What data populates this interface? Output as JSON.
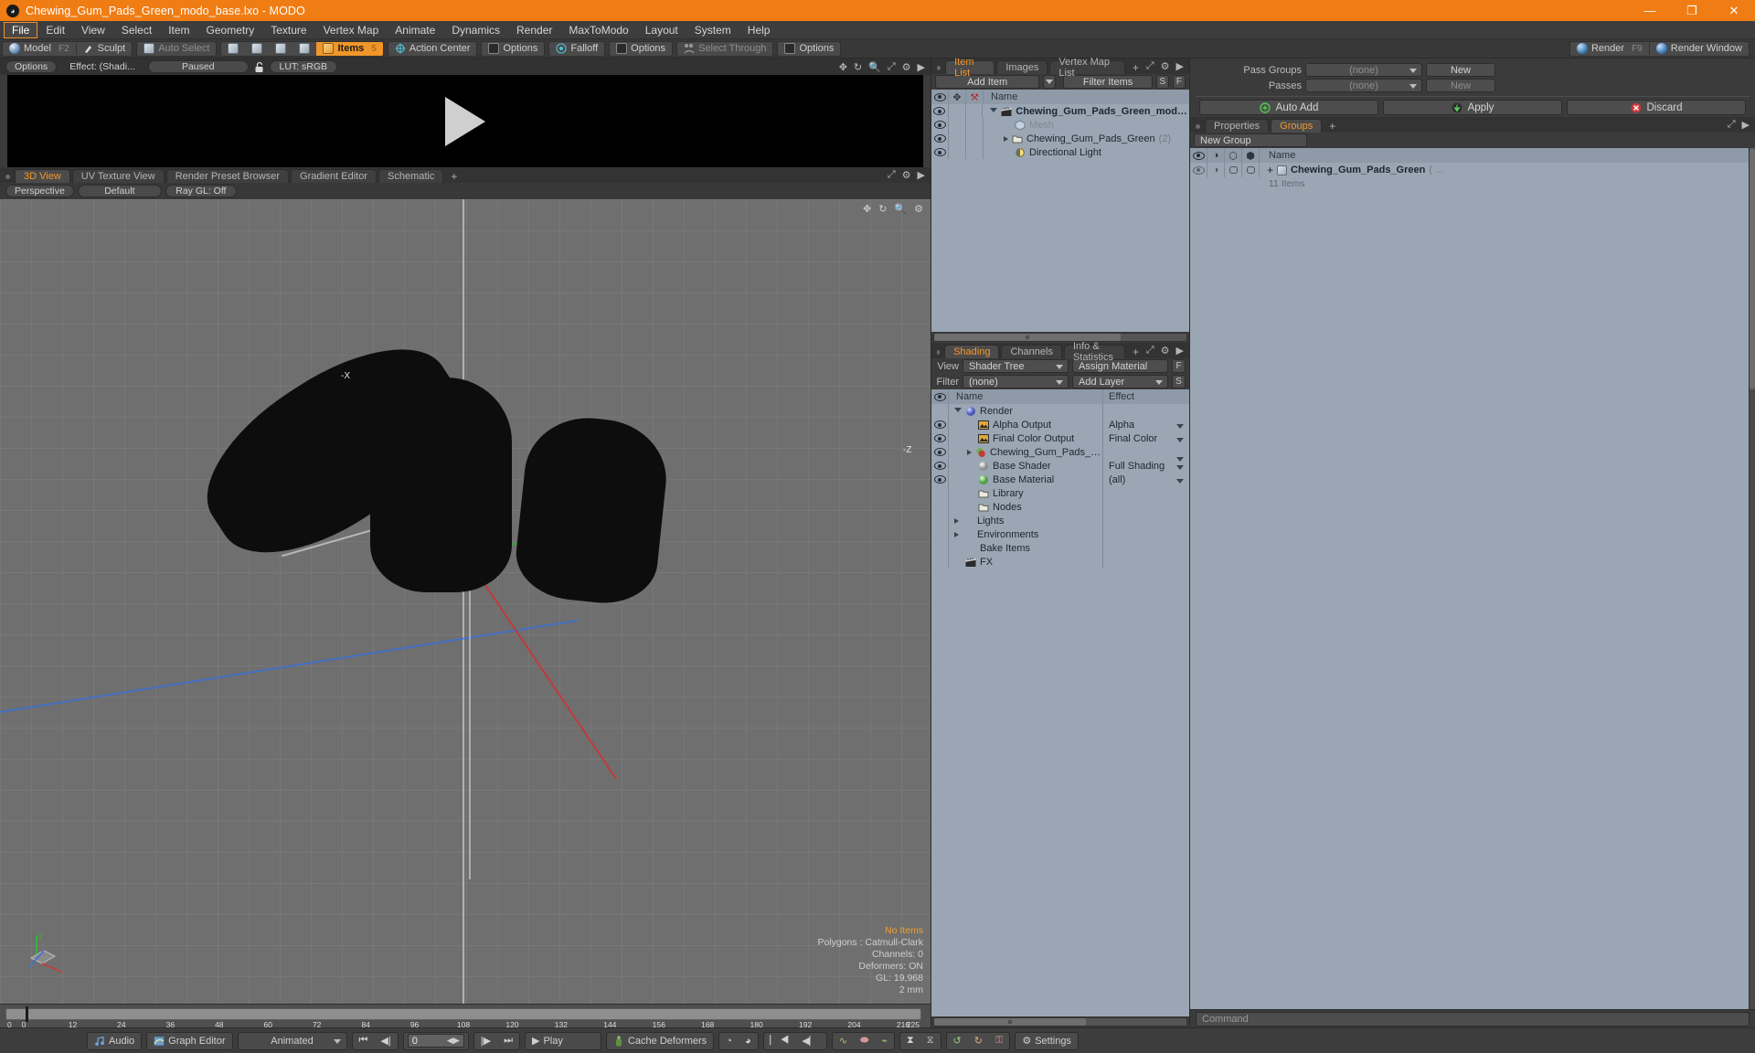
{
  "window": {
    "title": "Chewing_Gum_Pads_Green_modo_base.lxo - MODO",
    "app_icon": "modo-icon",
    "minimize": "—",
    "maximize": "❐",
    "close": "✕"
  },
  "menu": {
    "items": [
      "File",
      "Edit",
      "View",
      "Select",
      "Item",
      "Geometry",
      "Texture",
      "Vertex Map",
      "Animate",
      "Dynamics",
      "Render",
      "MaxToModo",
      "Layout",
      "System",
      "Help"
    ],
    "selected": "File"
  },
  "toolbar": {
    "mode_model": "Model",
    "mode_model_key": "F2",
    "mode_sculpt": "Sculpt",
    "auto_select": "Auto Select",
    "items": "Items",
    "items_key": "5",
    "action_center": "Action Center",
    "options1": "Options",
    "falloff": "Falloff",
    "options2": "Options",
    "select_through": "Select Through",
    "options3": "Options",
    "render": "Render",
    "render_key": "F9",
    "render_window": "Render Window"
  },
  "preview": {
    "options": "Options",
    "effect": "Effect: (Shadi...",
    "paused": "Paused",
    "lock_icon": "unlocked-padlock-icon",
    "lut": "LUT: sRGB",
    "icons": [
      "pan-icon",
      "rotate-icon",
      "zoom-icon",
      "fit-icon",
      "gear-icon",
      "arrow-right-icon"
    ]
  },
  "viewport_tabs": {
    "tabs": [
      "3D View",
      "UV Texture View",
      "Render Preset Browser",
      "Gradient Editor",
      "Schematic"
    ],
    "active": "3D View",
    "plus": "+"
  },
  "viewport": {
    "perspective": "Perspective",
    "default": "Default",
    "raygl": "Ray GL: Off",
    "icons": [
      "pan-icon",
      "rotate-icon",
      "zoom-icon",
      "gear-icon"
    ],
    "axis_x_label": "-X",
    "axis_z_label": "-Z",
    "info": {
      "selection": "No Items",
      "polygons": "Polygons : Catmull-Clark",
      "channels": "Channels: 0",
      "deformers": "Deformers: ON",
      "gl": "GL: 19,968",
      "unit": "2 mm"
    },
    "gizmo_axes": [
      "y",
      "x",
      "z"
    ]
  },
  "timeline": {
    "ticks": [
      "0",
      "12",
      "24",
      "36",
      "48",
      "60",
      "72",
      "84",
      "96",
      "108",
      "120",
      "132",
      "144",
      "156",
      "168",
      "180",
      "192",
      "204",
      "216"
    ],
    "start": "0",
    "end": "225",
    "range_label": "225"
  },
  "item_list": {
    "tabs": [
      "Item List",
      "Images",
      "Vertex Map List"
    ],
    "active": "Item List",
    "plus": "+",
    "add_item": "Add Item",
    "filter_placeholder": "Filter Items",
    "btn_s": "S",
    "btn_f": "F",
    "columns": [
      "eye-icon",
      "move-icon",
      "axis-icon",
      "Name"
    ],
    "rows": [
      {
        "name": "Chewing_Gum_Pads_Green_modo...",
        "icon": "scene-icon",
        "depth": 0,
        "expanded": true,
        "bold": true,
        "suffix": ""
      },
      {
        "name": "Mesh",
        "icon": "mesh-icon",
        "depth": 1,
        "expanded": false,
        "bold": false,
        "suffix": "",
        "dim": true
      },
      {
        "name": "Chewing_Gum_Pads_Green",
        "icon": "group-icon",
        "depth": 1,
        "expanded": false,
        "bold": false,
        "suffix": "(2)"
      },
      {
        "name": "Directional Light",
        "icon": "light-icon",
        "depth": 1,
        "expanded": false,
        "bold": false,
        "suffix": ""
      }
    ]
  },
  "shading": {
    "tabs": [
      "Shading",
      "Channels",
      "Info & Statistics"
    ],
    "active": "Shading",
    "plus": "+",
    "view_label": "View",
    "view_value": "Shader Tree",
    "assign_material": "Assign Material",
    "filter_label": "Filter",
    "filter_value": "(none)",
    "add_layer": "Add Layer",
    "btn_f": "F",
    "btn_s": "S",
    "columns": [
      "eye-icon",
      "Name",
      "Effect"
    ],
    "rows": [
      {
        "name": "Render",
        "effect": "",
        "depth": 0,
        "icon": "sphere-blue-icon",
        "expanded": true,
        "eye": false,
        "hasmenu": false
      },
      {
        "name": "Alpha Output",
        "effect": "Alpha",
        "depth": 1,
        "icon": "image-icon",
        "eye": true,
        "hasmenu": true
      },
      {
        "name": "Final Color Output",
        "effect": "Final Color",
        "depth": 1,
        "icon": "image-icon",
        "eye": true,
        "hasmenu": true
      },
      {
        "name": "Chewing_Gum_Pads_Gree ...",
        "effect": "",
        "depth": 1,
        "icon": "material-red-icon",
        "eye": true,
        "hasmenu": true,
        "arrow": true
      },
      {
        "name": "Base Shader",
        "effect": "Full Shading",
        "depth": 1,
        "icon": "sphere-grey-icon",
        "eye": true,
        "hasmenu": true
      },
      {
        "name": "Base Material",
        "effect": "(all)",
        "depth": 1,
        "icon": "sphere-green-icon",
        "eye": true,
        "hasmenu": true
      },
      {
        "name": "Library",
        "effect": "",
        "depth": 1,
        "icon": "folder-icon",
        "eye": false,
        "hasmenu": false
      },
      {
        "name": "Nodes",
        "effect": "",
        "depth": 1,
        "icon": "folder-icon",
        "eye": false,
        "hasmenu": false
      },
      {
        "name": "Lights",
        "effect": "",
        "depth": 0,
        "icon": "none",
        "eye": false,
        "arrow": true,
        "hasmenu": false
      },
      {
        "name": "Environments",
        "effect": "",
        "depth": 0,
        "icon": "none",
        "eye": false,
        "arrow": true,
        "hasmenu": false
      },
      {
        "name": "Bake Items",
        "effect": "",
        "depth": 0,
        "icon": "none",
        "eye": false,
        "hasmenu": false
      },
      {
        "name": "FX",
        "effect": "",
        "depth": 0,
        "icon": "scene-icon",
        "eye": false,
        "hasmenu": false
      }
    ]
  },
  "passes": {
    "pass_groups_label": "Pass Groups",
    "pass_groups_value": "(none)",
    "pass_groups_new": "New",
    "passes_label": "Passes",
    "passes_value": "(none)",
    "passes_new": "New",
    "auto_add": "Auto Add",
    "apply": "Apply",
    "discard": "Discard"
  },
  "groups": {
    "tabs": [
      "Properties",
      "Groups"
    ],
    "active": "Groups",
    "plus": "+",
    "new_group": "New Group",
    "columns": [
      "eye-icon",
      "render-icon",
      "wire-icon",
      "shade-icon",
      "Name"
    ],
    "rows": [
      {
        "name": "Chewing_Gum_Pads_Green",
        "suffix": "( ...",
        "sub": "11 Items"
      }
    ]
  },
  "command": {
    "placeholder": "Command"
  },
  "bottom_dock": {
    "audio": "Audio",
    "graph_editor": "Graph Editor",
    "animated": "Animated",
    "frame_value": "0",
    "play": "Play",
    "cache_deformers": "Cache Deformers",
    "settings": "Settings",
    "nav_icons": [
      "go-start-icon",
      "step-back-icon",
      "step-forward-icon",
      "go-end-icon"
    ],
    "key_icons": [
      "key-prev-icon",
      "key-next-icon",
      "key-first-icon",
      "key-last-icon",
      "curve-icon",
      "ellipse-icon",
      "handles-icon",
      "in-icon",
      "out-icon",
      "cycle-icon",
      "reload-icon",
      "lock-icon"
    ]
  }
}
